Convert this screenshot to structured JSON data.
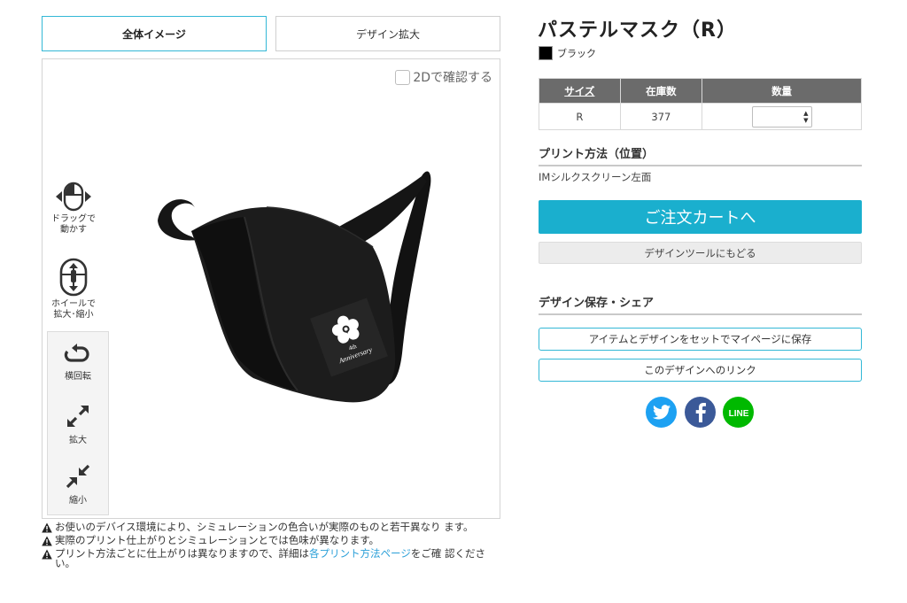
{
  "tabs": {
    "overall": "全体イメージ",
    "zoom": "デザイン拡大"
  },
  "viewer": {
    "check_2d": "2Dで確認する",
    "hint_drag": [
      "ドラッグで",
      "動かす"
    ],
    "hint_wheel": [
      "ホイールで",
      "拡大･縮小"
    ],
    "controls": {
      "rotate": "横回転",
      "enlarge": "拡大",
      "shrink": "縮小"
    },
    "print_text": {
      "line1": "4th",
      "line2": "Anniversary"
    }
  },
  "notes": [
    "お使いのデバイス環境により、シミュレーションの色合いが実際のものと若干異なり ます。",
    "実際のプリント仕上がりとシミュレーションとでは色味が異なります。"
  ],
  "note3": {
    "before": "プリント方法ごとに仕上がりは異なりますので、詳細は",
    "link": "各プリント方法ページ",
    "after": "をご確 認ください。"
  },
  "product": {
    "title": "パステルマスク（R）",
    "color_name": "ブラック",
    "color_hex": "#000000"
  },
  "table": {
    "headers": {
      "size": "サイズ",
      "stock": "在庫数",
      "qty": "数量"
    },
    "rows": [
      {
        "size": "R",
        "stock": "377",
        "qty": ""
      }
    ]
  },
  "print_method": {
    "heading": "プリント方法（位置）",
    "value": "IMシルクスクリーン左面"
  },
  "buttons": {
    "cart": "ご注文カートへ",
    "back": "デザインツールにもどる",
    "save": "アイテムとデザインをセットでマイページに保存",
    "link": "このデザインへのリンク"
  },
  "share": {
    "heading": "デザイン保存・シェア",
    "line_label": "LINE"
  },
  "colors": {
    "accent": "#1aafce",
    "header_bg": "#6b6b6b",
    "twitter": "#1da1f2",
    "facebook": "#3b5998",
    "line": "#00b900"
  }
}
